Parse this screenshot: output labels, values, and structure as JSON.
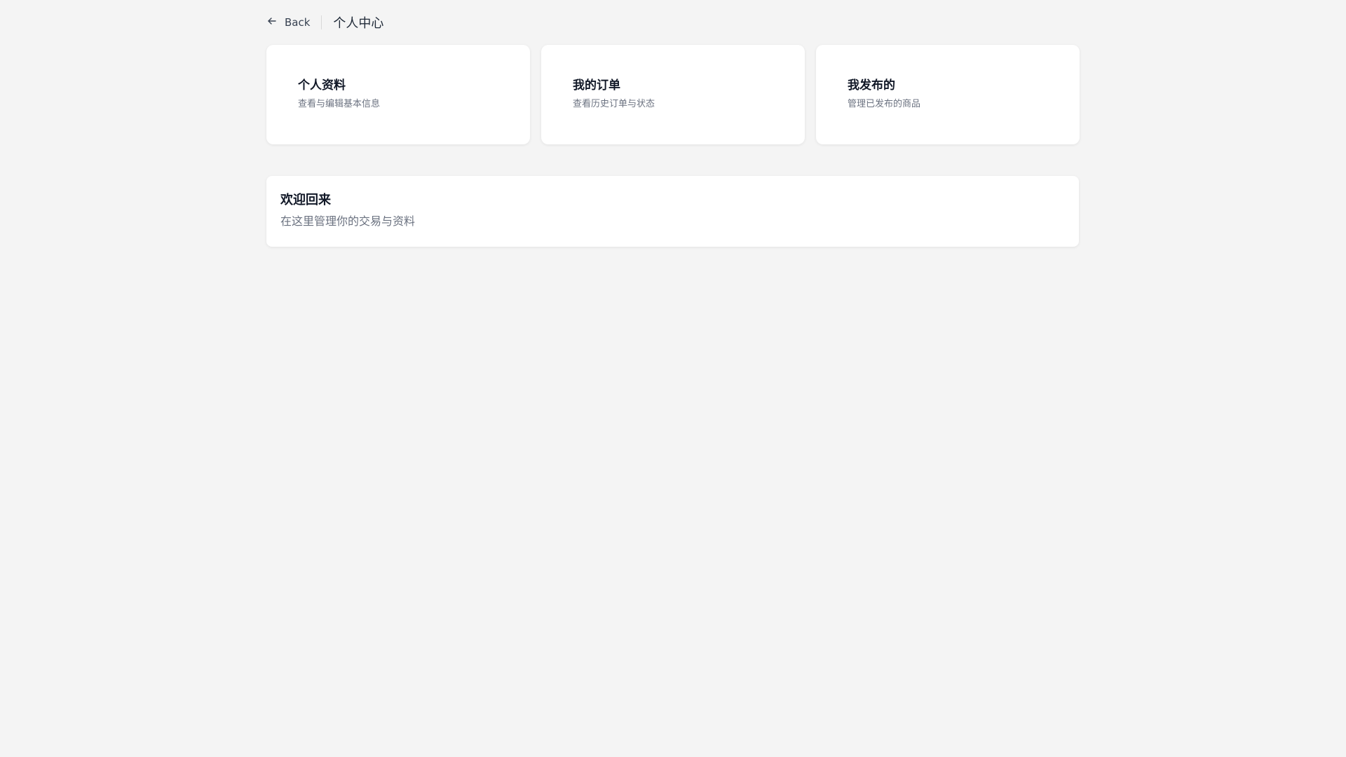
{
  "header": {
    "back_label": "Back",
    "title": "个人中心"
  },
  "cards": [
    {
      "title": "个人资料",
      "desc": "查看与编辑基本信息"
    },
    {
      "title": "我的订单",
      "desc": "查看历史订单与状态"
    },
    {
      "title": "我发布的",
      "desc": "管理已发布的商品"
    }
  ],
  "welcome": {
    "title": "欢迎回来",
    "subtitle": "在这里管理你的交易与资料"
  },
  "icons": {
    "back": "arrow-left-icon"
  },
  "colors": {
    "background": "#f4f4f4",
    "card": "#ffffff",
    "text_primary": "#111827",
    "text_secondary": "#6b7280"
  }
}
